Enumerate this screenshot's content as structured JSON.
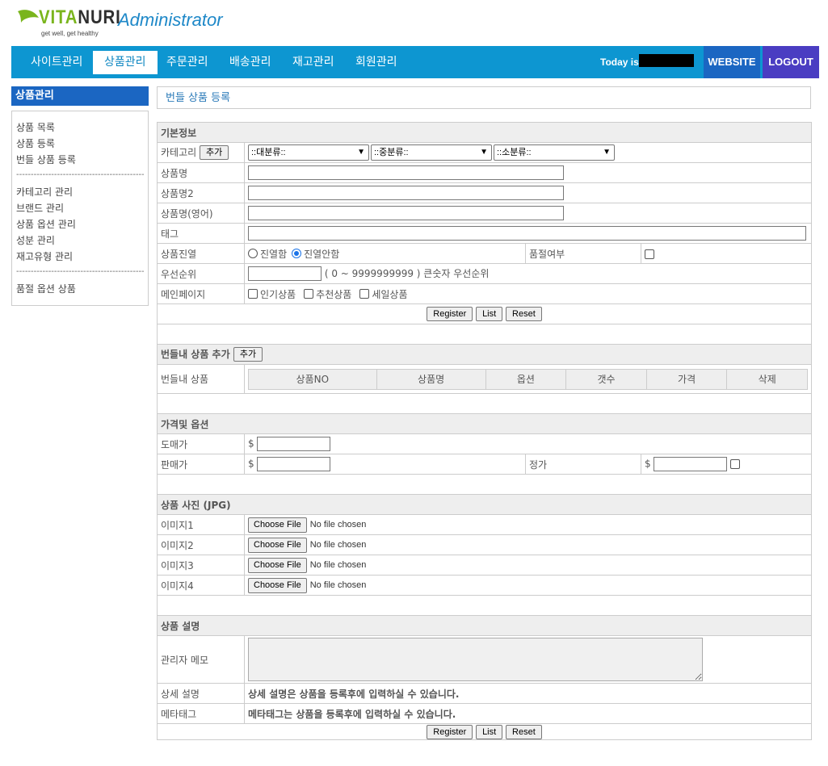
{
  "header": {
    "logo_text_a": "VITA",
    "logo_text_b": "NURI",
    "logo_tagline": "get well, get healthy",
    "title": "Administrator"
  },
  "nav": {
    "items": [
      "사이트관리",
      "상품관리",
      "주문관리",
      "배송관리",
      "재고관리",
      "회원관리"
    ],
    "active": "상품관리",
    "today_label": "Today is",
    "website": "WEBSITE",
    "logout": "LOGOUT"
  },
  "sidebar": {
    "title": "상품관리",
    "group1": [
      "상품 목록",
      "상품 등록",
      "번들 상품 등록"
    ],
    "separator": "--------------------------------------------",
    "group2": [
      "카테고리 관리",
      "브랜드 관리",
      "상품 옵션 관리",
      "성분 관리",
      "재고유형 관리"
    ],
    "group3": [
      "품절 옵션 상품"
    ]
  },
  "page": {
    "heading": "번들 상품 등록"
  },
  "basic": {
    "section": "기본정보",
    "category_label": "카테고리",
    "add_button": "추가",
    "select_major": "::대분류::",
    "select_middle": "::중분류::",
    "select_minor": "::소분류::",
    "name_label": "상품명",
    "name2_label": "상품명2",
    "name_en_label": "상품명(영어)",
    "tag_label": "태그",
    "display_label": "상품진열",
    "display_on": "진열함",
    "display_off": "진열안함",
    "soldout_label": "품절여부",
    "priority_label": "우선순위",
    "priority_hint": "( 0 ~ 9999999999 ) 큰숫자 우선순위",
    "mainpage_label": "메인페이지",
    "popular": "인기상품",
    "recommended": "추천상품",
    "sale": "세일상품"
  },
  "buttons": {
    "register": "Register",
    "list": "List",
    "reset": "Reset"
  },
  "bundle": {
    "section": "번들내 상품 추가",
    "add_button": "추가",
    "items_label": "번들내 상품",
    "columns": [
      "상품NO",
      "상품명",
      "옵션",
      "갯수",
      "가격",
      "삭제"
    ]
  },
  "price": {
    "section": "가격및 옵션",
    "wholesale_label": "도매가",
    "retail_label": "판매가",
    "regular_label": "정가",
    "currency": "$"
  },
  "photos": {
    "section": "상품 사진 (JPG)",
    "labels": [
      "이미지1",
      "이미지2",
      "이미지3",
      "이미지4"
    ],
    "choose": "Choose File",
    "none": "No file chosen"
  },
  "desc": {
    "section": "상품 설명",
    "memo_label": "관리자 메모",
    "detail_label": "상세 설명",
    "detail_note": "상세 설명은 상품을 등록후에 입력하실 수 있습니다.",
    "meta_label": "메타태그",
    "meta_note": "메타태그는 상품을 등록후에 입력하실 수 있습니다."
  },
  "colors": {
    "nav": "#0d96d1",
    "website": "#1b66c2",
    "logout": "#4a3dc2",
    "note": "#1d26b5"
  }
}
